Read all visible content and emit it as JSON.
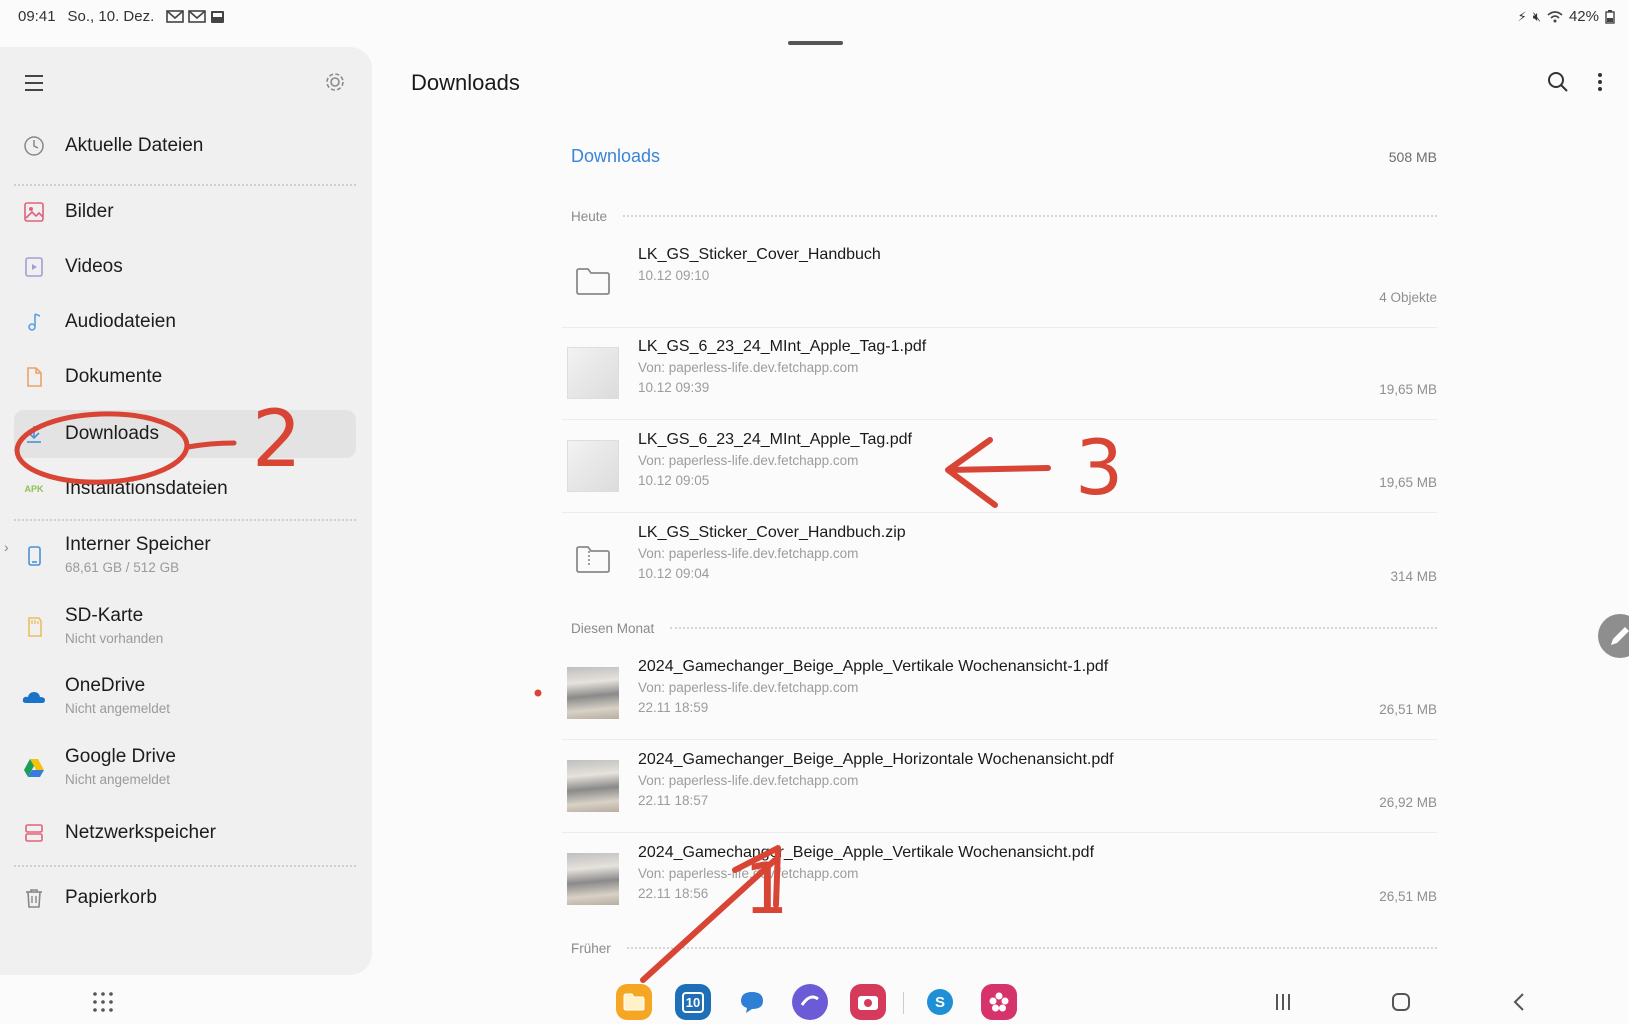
{
  "status_bar": {
    "time": "09:41",
    "date": "So., 10. Dez.",
    "battery": "42%"
  },
  "sidebar": {
    "items": [
      {
        "label": "Aktuelle Dateien",
        "icon": "clock-icon"
      },
      {
        "label": "Bilder",
        "icon": "image-icon"
      },
      {
        "label": "Videos",
        "icon": "video-icon"
      },
      {
        "label": "Audiodateien",
        "icon": "music-note-icon"
      },
      {
        "label": "Dokumente",
        "icon": "document-icon"
      },
      {
        "label": "Downloads",
        "icon": "download-icon"
      },
      {
        "label": "Installationsdateien",
        "icon": "apk-icon",
        "badge": "APK"
      },
      {
        "label": "Interner Speicher",
        "sub": "68,61 GB / 512 GB",
        "icon": "phone-storage-icon"
      },
      {
        "label": "SD-Karte",
        "sub": "Nicht vorhanden",
        "icon": "sd-card-icon"
      },
      {
        "label": "OneDrive",
        "sub": "Nicht angemeldet",
        "icon": "onedrive-icon"
      },
      {
        "label": "Google Drive",
        "sub": "Nicht angemeldet",
        "icon": "google-drive-icon"
      },
      {
        "label": "Netzwerkspeicher",
        "icon": "network-storage-icon"
      },
      {
        "label": "Papierkorb",
        "icon": "trash-icon"
      }
    ]
  },
  "main": {
    "title": "Downloads",
    "breadcrumb": "Downloads",
    "total_size": "508 MB",
    "sections": [
      {
        "label": "Heute",
        "files": [
          {
            "name": "LK_GS_Sticker_Cover_Handbuch",
            "source": "",
            "date": "10.12 09:10",
            "size": "4 Objekte",
            "type": "folder"
          },
          {
            "name": "LK_GS_6_23_24_MInt_Apple_Tag-1.pdf",
            "source": "Von: paperless-life.dev.fetchapp.com",
            "date": "10.12 09:39",
            "size": "19,65 MB",
            "type": "pdf"
          },
          {
            "name": "LK_GS_6_23_24_MInt_Apple_Tag.pdf",
            "source": "Von: paperless-life.dev.fetchapp.com",
            "date": "10.12 09:05",
            "size": "19,65 MB",
            "type": "pdf"
          },
          {
            "name": "LK_GS_Sticker_Cover_Handbuch.zip",
            "source": "Von: paperless-life.dev.fetchapp.com",
            "date": "10.12 09:04",
            "size": "314 MB",
            "type": "zip"
          }
        ]
      },
      {
        "label": "Diesen Monat",
        "files": [
          {
            "name": "2024_Gamechanger_Beige_Apple_Vertikale Wochenansicht-1.pdf",
            "source": "Von: paperless-life.dev.fetchapp.com",
            "date": "22.11 18:59",
            "size": "26,51 MB",
            "type": "photo"
          },
          {
            "name": "2024_Gamechanger_Beige_Apple_Horizontale Wochenansicht.pdf",
            "source": "Von: paperless-life.dev.fetchapp.com",
            "date": "22.11 18:57",
            "size": "26,92 MB",
            "type": "photo"
          },
          {
            "name": "2024_Gamechanger_Beige_Apple_Vertikale Wochenansicht.pdf",
            "source": "Von: paperless-life.dev.fetchapp.com",
            "date": "22.11 18:56",
            "size": "26,51 MB",
            "type": "photo"
          }
        ]
      },
      {
        "label": "Früher",
        "files": []
      }
    ]
  },
  "dock": {
    "apps": [
      {
        "name": "my-files-app-icon",
        "color": "#f5a623"
      },
      {
        "name": "calendar-app-icon",
        "color": "#1e6fb8",
        "label": "10"
      },
      {
        "name": "messages-app-icon",
        "color": "#2f7fd6"
      },
      {
        "name": "internet-app-icon",
        "color": "#6b5bd6"
      },
      {
        "name": "camera-app-icon",
        "color": "#d63a5a"
      },
      {
        "name": "skype-app-icon",
        "color": "#1f8fd6",
        "label": "S"
      },
      {
        "name": "flower-app-icon",
        "color": "#d6336c"
      }
    ]
  },
  "annotations": {
    "label_1": "1",
    "label_2": "2",
    "label_3": "3",
    "color": "#d84535"
  },
  "colors": {
    "accent": "#3a84d8",
    "sidebar_bg": "#f0f0f0",
    "active_item": "#e3e3e3"
  }
}
